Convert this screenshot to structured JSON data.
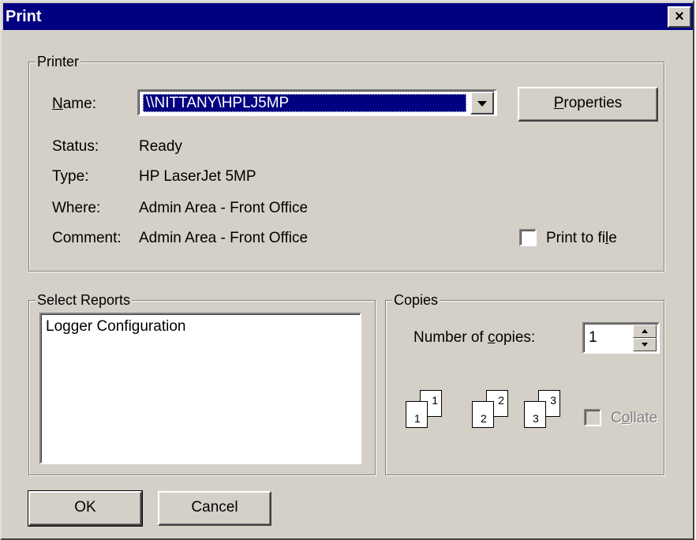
{
  "window": {
    "title": "Print",
    "close_label": "×"
  },
  "printer_group": {
    "label": "Printer",
    "name_label": "Name:",
    "name_value": "\\\\NITTANY\\HPLJ5MP",
    "properties_button": "Properties",
    "status_label": "Status:",
    "status_value": "Ready",
    "type_label": "Type:",
    "type_value": "HP LaserJet 5MP",
    "where_label": "Where:",
    "where_value": "Admin Area - Front Office",
    "comment_label": "Comment:",
    "comment_value": "Admin Area - Front Office",
    "print_to_file_label": "Print to file",
    "print_to_file_checked": false
  },
  "reports_group": {
    "label": "Select Reports",
    "items": [
      "Logger Configuration"
    ]
  },
  "copies_group": {
    "label": "Copies",
    "number_label": "Number of copies:",
    "number_value": "1",
    "collate_label": "Collate",
    "collate_enabled": false,
    "page_numbers": [
      "1",
      "1",
      "2",
      "2",
      "3",
      "3"
    ]
  },
  "buttons": {
    "ok": "OK",
    "cancel": "Cancel"
  },
  "colors": {
    "titlebar": "#000080",
    "face": "#d4d0c8",
    "selection": "#000080"
  }
}
